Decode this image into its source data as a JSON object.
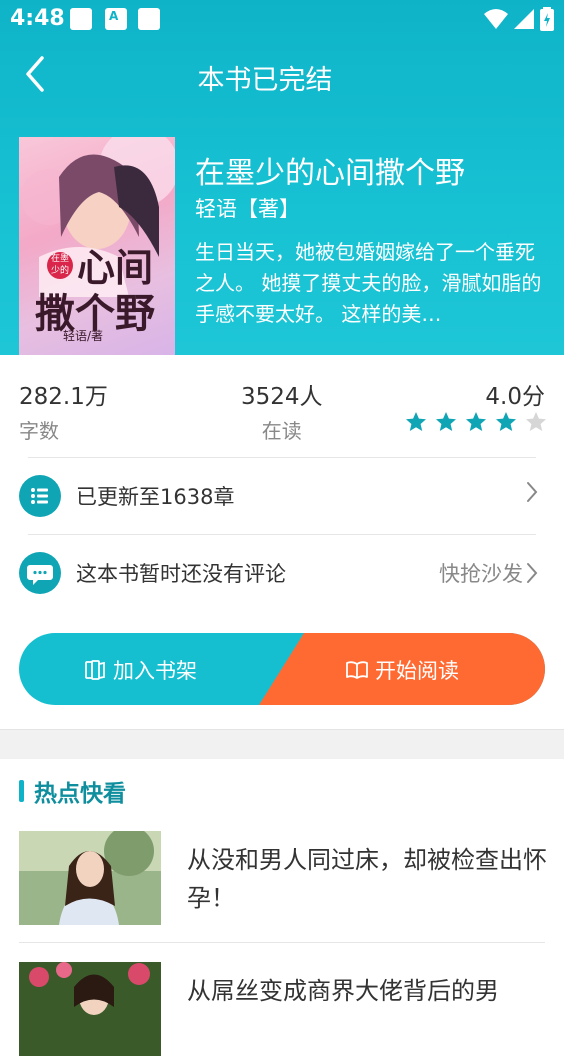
{
  "status": {
    "time": "4:48",
    "notif_text": "A"
  },
  "nav": {
    "title": "本书已完结"
  },
  "book": {
    "title": "在墨少的心间撒个野",
    "author": "轻语【著】",
    "description": "生日当天，她被包婚姻嫁给了一个垂死之人。 她摸了摸丈夫的脸，滑腻如脂的手感不要太好。 这样的美…",
    "cover_text": {
      "small": "在墨少的",
      "line1": "心间",
      "line2": "撒个野",
      "author": "轻语/著"
    }
  },
  "stats": {
    "words": {
      "value": "282.1万",
      "label": "字数"
    },
    "readers": {
      "value": "3524人",
      "label": "在读"
    },
    "score": {
      "value": "4.0分",
      "stars": 4,
      "max_stars": 5
    }
  },
  "chapters": {
    "text": "已更新至1638章"
  },
  "comments": {
    "text": "这本书暂时还没有评论",
    "action": "快抢沙发"
  },
  "actions": {
    "shelf": "加入书架",
    "read": "开始阅读"
  },
  "hot": {
    "title": "热点快看",
    "articles": [
      {
        "title": "从没和男人同过床，却被检查出怀孕！"
      },
      {
        "title": "从屌丝变成商界大佬背后的男"
      }
    ]
  },
  "colors": {
    "accent": "#16bfd0",
    "orange": "#ff6a33",
    "star": "#10a5b5"
  }
}
